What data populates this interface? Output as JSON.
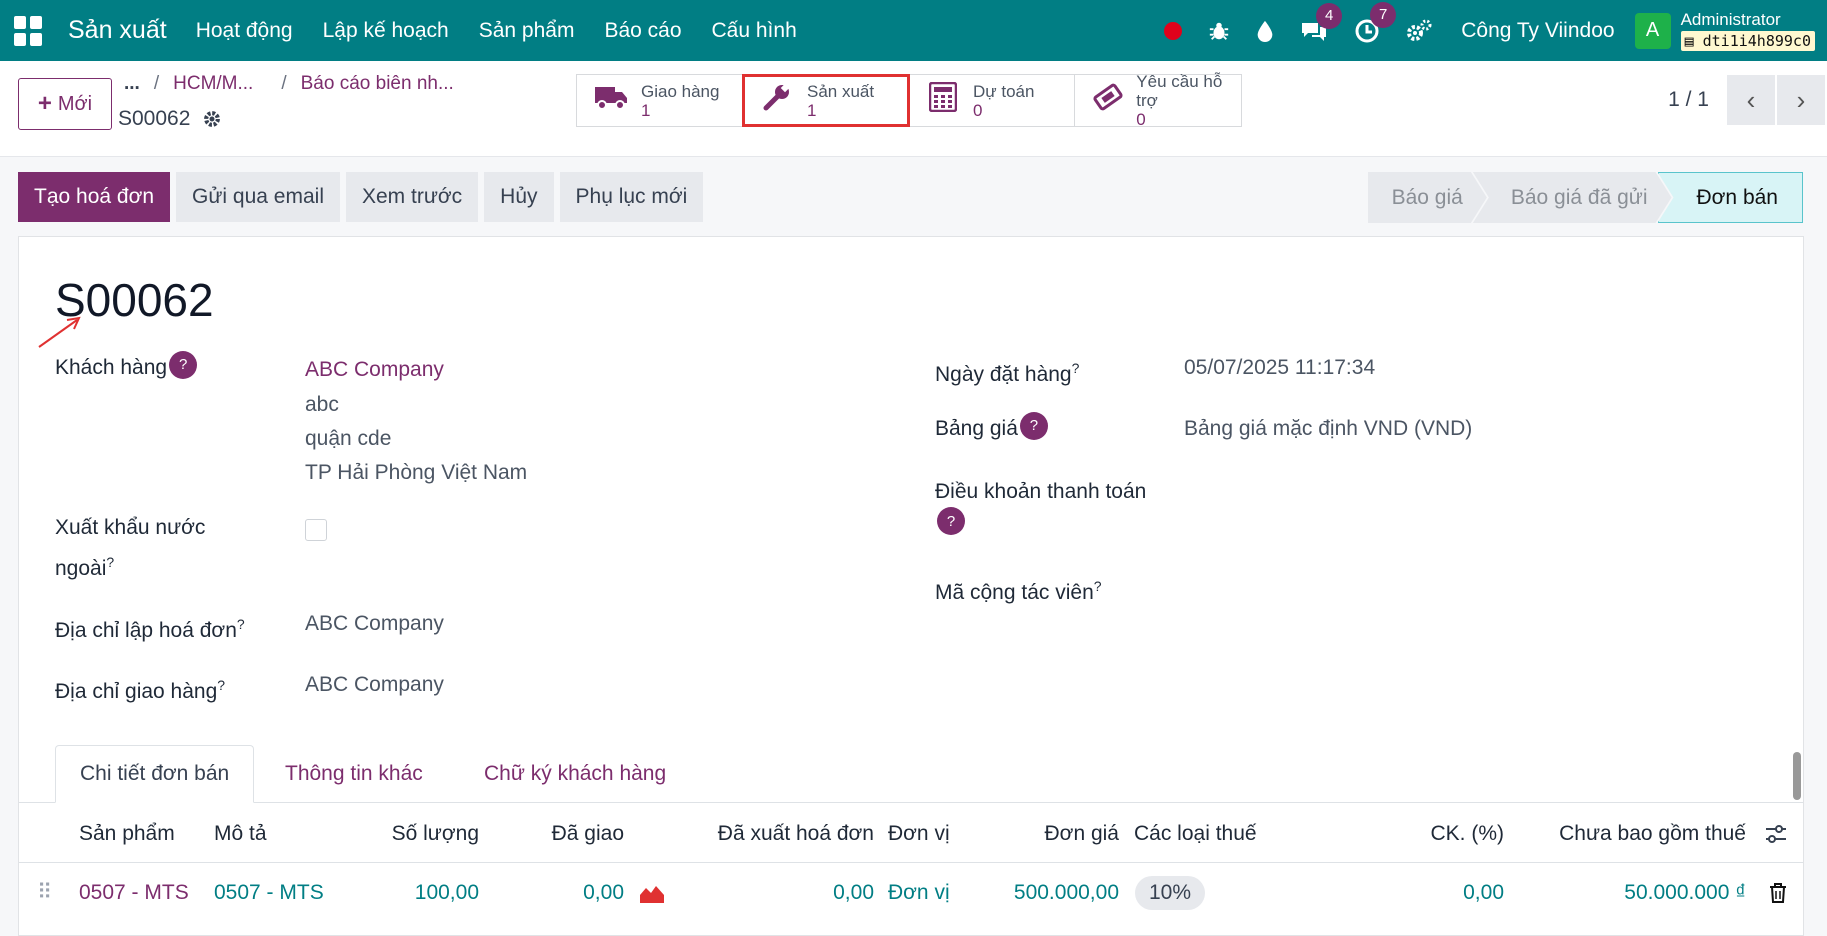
{
  "topbar": {
    "app_title": "Sản xuất",
    "menu": [
      "Hoạt động",
      "Lập kế hoạch",
      "Sản phẩm",
      "Báo cáo",
      "Cấu hình"
    ],
    "chat_badge": "4",
    "activity_badge": "7",
    "company": "Công Ty Viindoo",
    "avatar_letter": "A",
    "user_name": "Administrator",
    "db_name": "dti1i4h899c0"
  },
  "control": {
    "new_label": "Mới",
    "breadcrumb": [
      "...",
      "HCM/M...",
      "Báo cáo biên nh..."
    ],
    "record_name": "S00062",
    "smart_buttons": [
      {
        "icon": "truck-icon",
        "label": "Giao hàng",
        "value": "1"
      },
      {
        "icon": "wrench-icon",
        "label": "Sản xuất",
        "value": "1"
      },
      {
        "icon": "calculator-icon",
        "label": "Dự toán",
        "value": "0"
      },
      {
        "icon": "ticket-icon",
        "label": "Yêu cầu hỗ trợ",
        "value": "0"
      }
    ],
    "pager": "1 / 1"
  },
  "actions": [
    "Tạo hoá đơn",
    "Gửi qua email",
    "Xem trước",
    "Hủy",
    "Phụ lục mới"
  ],
  "status": [
    "Báo giá",
    "Báo giá đã gửi",
    "Đơn bán"
  ],
  "form": {
    "title": "S00062",
    "customer_label": "Khách hàng",
    "customer_name": "ABC Company",
    "customer_addr1": "abc",
    "customer_addr2": "quận cde",
    "customer_addr3": "TP Hải Phòng Việt Nam",
    "export_label_1": "Xuất khẩu nước",
    "export_label_2": "ngoài",
    "invoice_addr_label": "Địa chỉ lập hoá đơn",
    "invoice_addr": "ABC Company",
    "delivery_addr_label": "Địa chỉ giao hàng",
    "delivery_addr": "ABC Company",
    "order_date_label": "Ngày đặt hàng",
    "order_date": "05/07/2025 11:17:34",
    "pricelist_label": "Bảng giá",
    "pricelist": "Bảng giá mặc định VND (VND)",
    "payment_terms_label": "Điều khoản thanh toán",
    "partner_label": "Mã cộng tác viên",
    "help_mark": "?",
    "sup_mark": "?"
  },
  "tabs": [
    "Chi tiết đơn bán",
    "Thông tin khác",
    "Chữ ký khách hàng"
  ],
  "table": {
    "headers": [
      "Sản phẩm",
      "Mô tả",
      "Số lượng",
      "Đã giao",
      "Đã xuất hoá đơn",
      "Đơn vị",
      "Đơn giá",
      "Các loại thuế",
      "CK. (%)",
      "Chưa bao gồm thuế"
    ],
    "row": {
      "product": "0507 - MTS",
      "description": "0507 - MTS",
      "quantity": "100,00",
      "delivered": "0,00",
      "invoiced": "0,00",
      "uom": "Đơn vị",
      "price": "500.000,00",
      "tax": "10%",
      "discount": "0,00",
      "subtotal": "50.000.000 ₫"
    }
  }
}
